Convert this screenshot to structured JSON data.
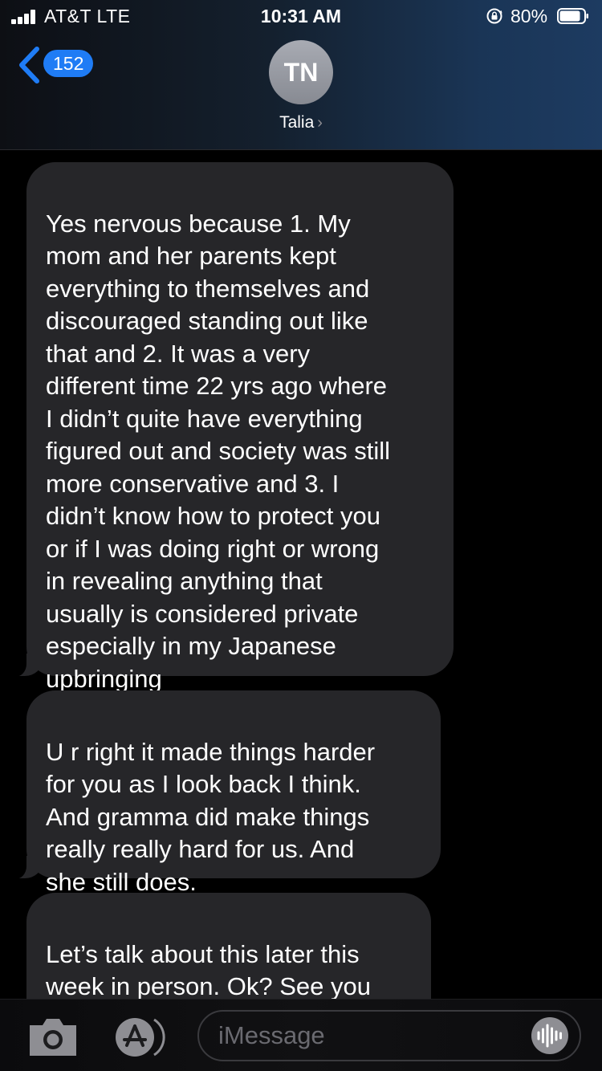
{
  "status_bar": {
    "carrier": "AT&T  LTE",
    "time": "10:31 AM",
    "battery_percent": "80%"
  },
  "nav": {
    "back_badge_count": "152",
    "contact_initials": "TN",
    "contact_name": "Talia",
    "chevron": "›"
  },
  "messages": [
    {
      "direction": "incoming",
      "text": "Yes nervous because 1. My\nmom and her parents kept\neverything to themselves and\ndiscouraged standing out like\nthat and 2. It was a very\ndifferent time 22 yrs ago where\nI didn’t quite have everything\nfigured out and society was still\nmore conservative and 3. I\ndidn’t know how to protect you\nor if I was doing right or wrong\nin revealing anything that\nusually is considered private\nespecially in my Japanese\nupbringing"
    },
    {
      "direction": "incoming",
      "text": "U r right it made things harder\nfor you as I look back I think.\nAnd gramma did make things\nreally really hard for us. And\nshe still does."
    },
    {
      "direction": "incoming",
      "text": "Let’s talk about this later this\nweek in person. Ok?  See you\nsoon.  Call u around Tuesday"
    }
  ],
  "input_bar": {
    "placeholder": "iMessage",
    "icons": [
      "camera-icon",
      "app-store-icon",
      "audio-waveform-icon"
    ]
  },
  "colors": {
    "bubble_incoming": "#262629",
    "badge_blue": "#1f7cf5",
    "background": "#000000"
  }
}
